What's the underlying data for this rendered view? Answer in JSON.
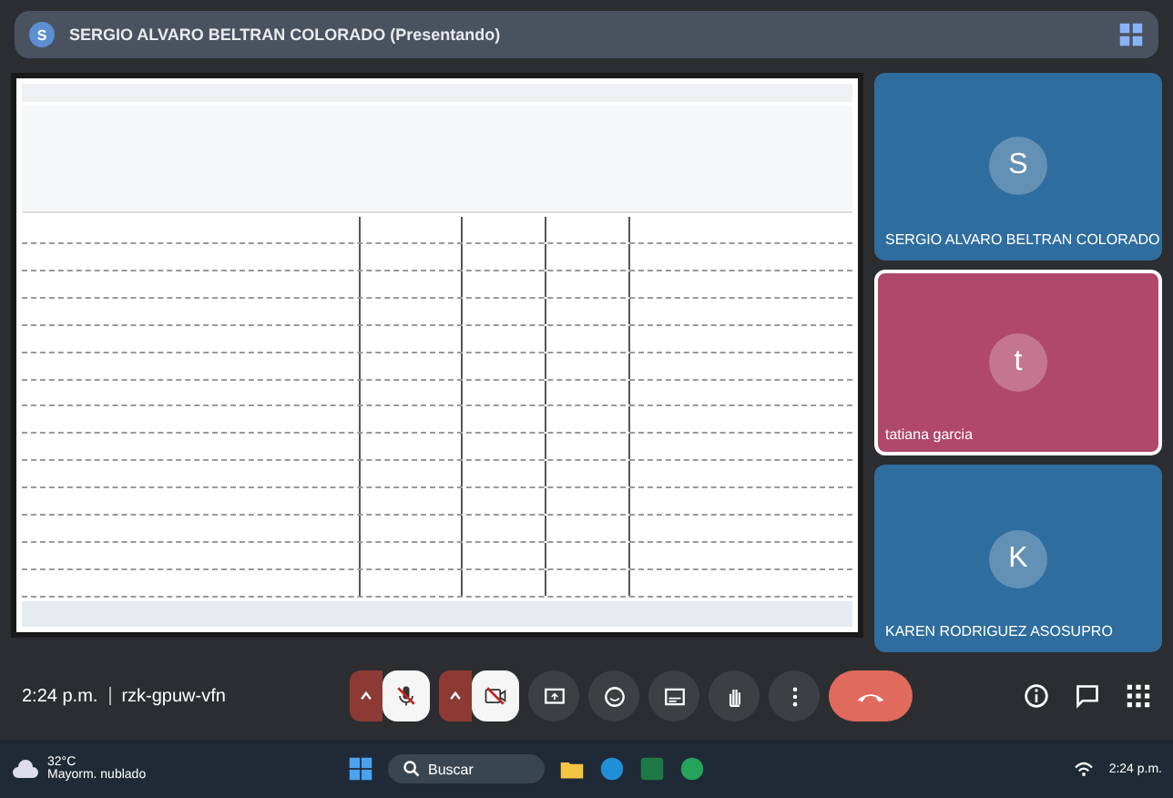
{
  "presenter_banner": {
    "avatar": "S",
    "title": "SERGIO ALVARO BELTRAN COLORADO (Presentando)"
  },
  "participants": [
    {
      "initial": "S",
      "name": "SERGIO ALVARO BELTRAN COLORADO",
      "color": "#2f6d9e",
      "selected": false
    },
    {
      "initial": "t",
      "name": "tatiana garcia",
      "color": "#b0486b",
      "selected": true
    },
    {
      "initial": "K",
      "name": "KAREN RODRIGUEZ ASOSUPRO",
      "color": "#2f6d9e",
      "selected": false
    }
  ],
  "meeting": {
    "time": "2:24 p.m.",
    "code": "rzk-gpuw-vfn"
  },
  "controls": [
    {
      "kind": "mic",
      "off": true
    },
    {
      "kind": "camera",
      "off": true
    },
    {
      "kind": "present"
    },
    {
      "kind": "emoji"
    },
    {
      "kind": "captions"
    },
    {
      "kind": "hand"
    },
    {
      "kind": "more"
    },
    {
      "kind": "end"
    }
  ],
  "taskbar": {
    "weather": "32°C",
    "weather_label": "Mayorm. nublado",
    "search": "Buscar",
    "clock": "2:24 p.m."
  }
}
